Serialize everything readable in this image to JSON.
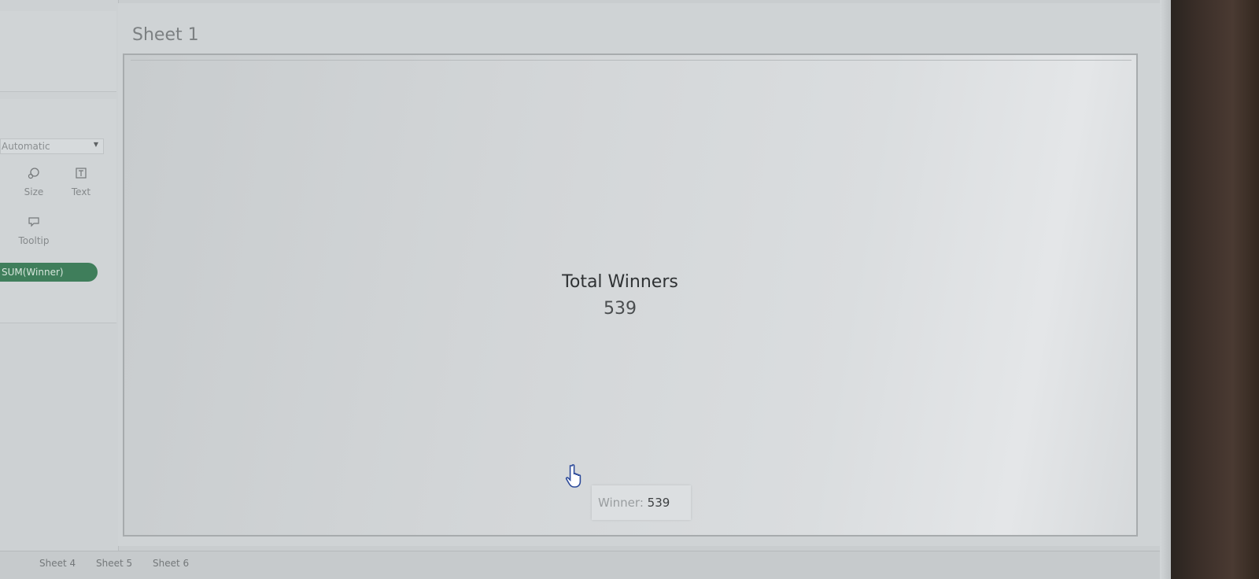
{
  "sheet": {
    "title": "Sheet 1"
  },
  "marks_card": {
    "mark_type": "Automatic",
    "buttons": [
      {
        "label": "Size",
        "icon": "size-icon"
      },
      {
        "label": "Text",
        "icon": "text-icon"
      },
      {
        "label": "Tooltip",
        "icon": "tooltip-icon"
      }
    ],
    "pill_label": "SUM(Winner)",
    "pill_color": "#3f7e5b"
  },
  "viz": {
    "kpi_title": "Total Winners",
    "kpi_value": "539"
  },
  "tooltip": {
    "key": "Winner:",
    "value": "539"
  },
  "tabs": [
    "Sheet 4",
    "Sheet 5",
    "Sheet 6"
  ]
}
